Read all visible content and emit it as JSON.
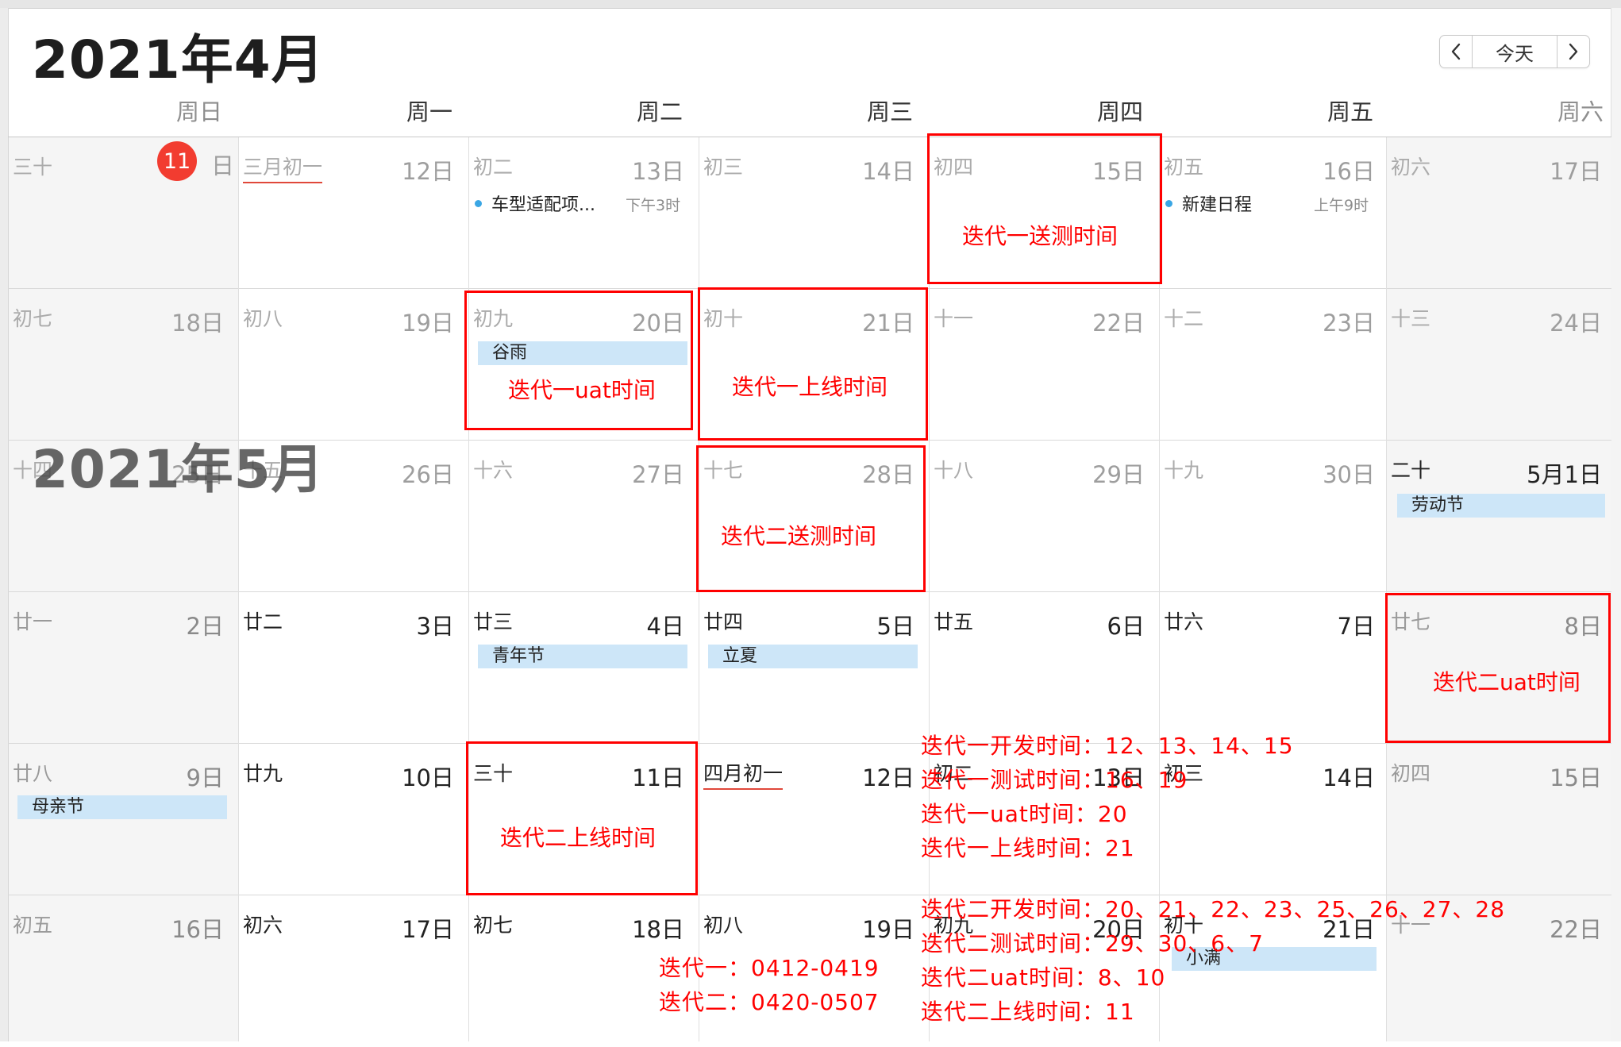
{
  "calendar": {
    "month_title": "2021年4月",
    "next_month_title": "2021年5月",
    "today_day": "11",
    "today_suffix": "日",
    "nav": {
      "prev_icon": "chevron-left",
      "next_icon": "chevron-right",
      "today_label": "今天"
    },
    "weekdays": [
      "周日",
      "周一",
      "周二",
      "周三",
      "周四",
      "周五",
      "周六"
    ],
    "weeks": [
      [
        {
          "lunar": "三十",
          "day": ""
        },
        {
          "lunar": "三月初一",
          "day": "12日"
        },
        {
          "lunar": "初二",
          "day": "13日"
        },
        {
          "lunar": "初三",
          "day": "14日"
        },
        {
          "lunar": "初四",
          "day": "15日"
        },
        {
          "lunar": "初五",
          "day": "16日"
        },
        {
          "lunar": "初六",
          "day": "17日"
        }
      ],
      [
        {
          "lunar": "初七",
          "day": "18日"
        },
        {
          "lunar": "初八",
          "day": "19日"
        },
        {
          "lunar": "初九",
          "day": "20日"
        },
        {
          "lunar": "初十",
          "day": "21日"
        },
        {
          "lunar": "十一",
          "day": "22日"
        },
        {
          "lunar": "十二",
          "day": "23日"
        },
        {
          "lunar": "十三",
          "day": "24日"
        }
      ],
      [
        {
          "lunar": "十四",
          "day": "25日"
        },
        {
          "lunar": "十五",
          "day": "26日"
        },
        {
          "lunar": "十六",
          "day": "27日"
        },
        {
          "lunar": "十七",
          "day": "28日"
        },
        {
          "lunar": "十八",
          "day": "29日"
        },
        {
          "lunar": "十九",
          "day": "30日"
        },
        {
          "lunar": "二十",
          "day": "5月1日"
        }
      ],
      [
        {
          "lunar": "廿一",
          "day": "2日"
        },
        {
          "lunar": "廿二",
          "day": "3日"
        },
        {
          "lunar": "廿三",
          "day": "4日"
        },
        {
          "lunar": "廿四",
          "day": "5日"
        },
        {
          "lunar": "廿五",
          "day": "6日"
        },
        {
          "lunar": "廿六",
          "day": "7日"
        },
        {
          "lunar": "廿七",
          "day": "8日"
        }
      ],
      [
        {
          "lunar": "廿八",
          "day": "9日"
        },
        {
          "lunar": "廿九",
          "day": "10日"
        },
        {
          "lunar": "三十",
          "day": "11日"
        },
        {
          "lunar": "四月初一",
          "day": "12日"
        },
        {
          "lunar": "初二",
          "day": "13日"
        },
        {
          "lunar": "初三",
          "day": "14日"
        },
        {
          "lunar": "初四",
          "day": "15日"
        }
      ],
      [
        {
          "lunar": "初五",
          "day": "16日"
        },
        {
          "lunar": "初六",
          "day": "17日"
        },
        {
          "lunar": "初七",
          "day": "18日"
        },
        {
          "lunar": "初八",
          "day": "19日"
        },
        {
          "lunar": "初九",
          "day": "20日"
        },
        {
          "lunar": "初十",
          "day": "21日"
        },
        {
          "lunar": "十一",
          "day": "22日"
        }
      ]
    ],
    "events": {
      "car_adapt": {
        "title": "车型适配项...",
        "time": "下午3时"
      },
      "new_event": {
        "title": "新建日程",
        "time": "上午9时"
      },
      "guyu": "谷雨",
      "labor_day": "劳动节",
      "youth_day": "青年节",
      "lixia": "立夏",
      "mothers_day": "母亲节",
      "xiaoman": "小满"
    },
    "colors": {
      "today_badge": "#f23c30",
      "holiday_fill": "#cde6f8",
      "event_dot": "#3aa6e4",
      "annotation": "#ff0000"
    }
  },
  "annotations": {
    "boxes": {
      "iter1_test": "迭代一送测时间",
      "iter1_uat": "迭代一uat时间",
      "iter1_release": "迭代一上线时间",
      "iter2_test": "迭代二送测时间",
      "iter2_uat": "迭代二uat时间",
      "iter2_release": "迭代二上线时间"
    },
    "notes_block1": [
      "迭代一开发时间：12、13、14、15",
      "迭代一测试时间：16、19",
      "迭代一uat时间：20",
      "迭代一上线时间：21"
    ],
    "notes_block2": [
      "迭代二开发时间：20、21、22、23、25、26、27、28",
      "迭代二测试时间：29、30、6、7",
      "迭代二uat时间：8、10",
      "迭代二上线时间：11"
    ],
    "ranges": [
      "迭代一：0412-0419",
      "迭代二：0420-0507"
    ]
  }
}
